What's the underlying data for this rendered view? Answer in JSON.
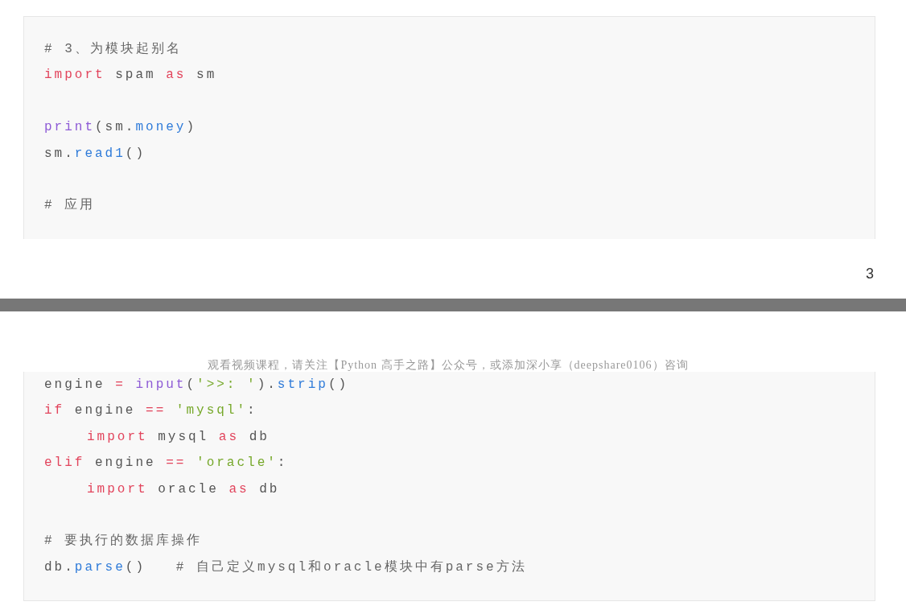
{
  "pages": [
    {
      "code_lines": [
        {
          "kind": "code",
          "tokens": [
            {
              "kind": "comment",
              "text": "# 3、为模块起别名"
            }
          ]
        },
        {
          "kind": "code",
          "tokens": [
            {
              "kind": "keyword",
              "text": "import"
            },
            {
              "kind": "plain",
              "text": " spam "
            },
            {
              "kind": "keyword",
              "text": "as"
            },
            {
              "kind": "plain",
              "text": " sm"
            }
          ]
        },
        {
          "kind": "blank"
        },
        {
          "kind": "code",
          "tokens": [
            {
              "kind": "builtin",
              "text": "print"
            },
            {
              "kind": "plain",
              "text": "(sm."
            },
            {
              "kind": "attr",
              "text": "money"
            },
            {
              "kind": "plain",
              "text": ")"
            }
          ]
        },
        {
          "kind": "code",
          "tokens": [
            {
              "kind": "plain",
              "text": "sm."
            },
            {
              "kind": "attr",
              "text": "read1"
            },
            {
              "kind": "plain",
              "text": "()"
            }
          ]
        },
        {
          "kind": "blank"
        },
        {
          "kind": "code",
          "tokens": [
            {
              "kind": "comment",
              "text": "# 应用"
            }
          ]
        }
      ],
      "page_number": "3"
    },
    {
      "header": "观看视频课程，请关注【Python 高手之路】公众号，或添加深小享（deepshare0106）咨询",
      "code_lines": [
        {
          "kind": "code",
          "tokens": [
            {
              "kind": "plain",
              "text": "engine"
            },
            {
              "kind": "keyword",
              "text": " = "
            },
            {
              "kind": "builtin",
              "text": "input"
            },
            {
              "kind": "plain",
              "text": "("
            },
            {
              "kind": "string",
              "text": "'>>: '"
            },
            {
              "kind": "plain",
              "text": ")."
            },
            {
              "kind": "attr",
              "text": "strip"
            },
            {
              "kind": "plain",
              "text": "()"
            }
          ]
        },
        {
          "kind": "code",
          "tokens": [
            {
              "kind": "keyword",
              "text": "if"
            },
            {
              "kind": "plain",
              "text": " engine"
            },
            {
              "kind": "keyword",
              "text": " == "
            },
            {
              "kind": "string",
              "text": "'mysql'"
            },
            {
              "kind": "plain",
              "text": ":"
            }
          ]
        },
        {
          "kind": "indented",
          "tokens": [
            {
              "kind": "keyword",
              "text": "import"
            },
            {
              "kind": "plain",
              "text": " mysql "
            },
            {
              "kind": "keyword",
              "text": "as"
            },
            {
              "kind": "plain",
              "text": " db"
            }
          ]
        },
        {
          "kind": "code",
          "tokens": [
            {
              "kind": "keyword",
              "text": "elif"
            },
            {
              "kind": "plain",
              "text": " engine"
            },
            {
              "kind": "keyword",
              "text": " == "
            },
            {
              "kind": "string",
              "text": "'oracle'"
            },
            {
              "kind": "plain",
              "text": ":"
            }
          ]
        },
        {
          "kind": "indented",
          "tokens": [
            {
              "kind": "keyword",
              "text": "import"
            },
            {
              "kind": "plain",
              "text": " oracle "
            },
            {
              "kind": "keyword",
              "text": "as"
            },
            {
              "kind": "plain",
              "text": " db"
            }
          ]
        },
        {
          "kind": "blank"
        },
        {
          "kind": "code",
          "tokens": [
            {
              "kind": "comment",
              "text": "# 要执行的数据库操作"
            }
          ]
        },
        {
          "kind": "code",
          "tokens": [
            {
              "kind": "plain",
              "text": "db."
            },
            {
              "kind": "attr",
              "text": "parse"
            },
            {
              "kind": "plain",
              "text": "()   "
            },
            {
              "kind": "comment",
              "text": "# 自己定义mysql和oracle模块中有parse方法"
            }
          ]
        }
      ]
    }
  ]
}
